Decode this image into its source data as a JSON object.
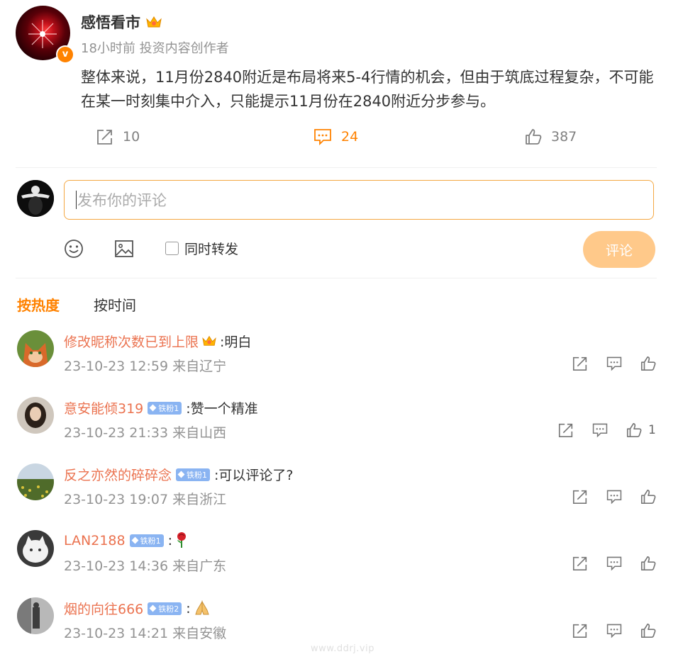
{
  "post": {
    "author": "感悟看市",
    "crown_icon": "crown-icon",
    "verified_icon": "v",
    "time": "18小时前",
    "author_tag": "投资内容创作者",
    "text": "整体来说，11月份2840附近是布局将来5-4行情的机会，但由于筑底过程复杂，不可能在某一时刻集中介入，只能提示11月份在2840附近分步参与。",
    "repost_count": "10",
    "comment_count": "24",
    "like_count": "387"
  },
  "composer": {
    "placeholder": "发布你的评论",
    "repost_checkbox_label": "同时转发",
    "submit_label": "评论"
  },
  "sort_tabs": {
    "hot": "按热度",
    "time": "按时间"
  },
  "comments": [
    {
      "name": "修改昵称次数已到上限",
      "badge": "",
      "text": ":明白",
      "time": "23-10-23 12:59 来自辽宁",
      "likes": ""
    },
    {
      "name": "意安能倾319",
      "badge": "铁粉1",
      "text": ":赞一个精准",
      "time": "23-10-23 21:33 来自山西",
      "likes": "1"
    },
    {
      "name": "反之亦然的碎碎念",
      "badge": "铁粉1",
      "text": ":可以评论了?",
      "time": "23-10-23 19:07 来自浙江",
      "likes": ""
    },
    {
      "name": "LAN2188",
      "badge": "铁粉1",
      "text": ":",
      "time": "23-10-23 14:36 来自广东",
      "likes": ""
    },
    {
      "name": "烟的向往666",
      "badge": "铁粉2",
      "text": ":",
      "time": "23-10-23 14:21 来自安徽",
      "likes": ""
    }
  ],
  "watermark": "www.ddrj.vip",
  "colors": {
    "accent": "#ff8200",
    "name": "#eb7350",
    "muted": "#939393",
    "fan_badge": "#8ab4f2",
    "submit_disabled": "#ffc98a"
  }
}
